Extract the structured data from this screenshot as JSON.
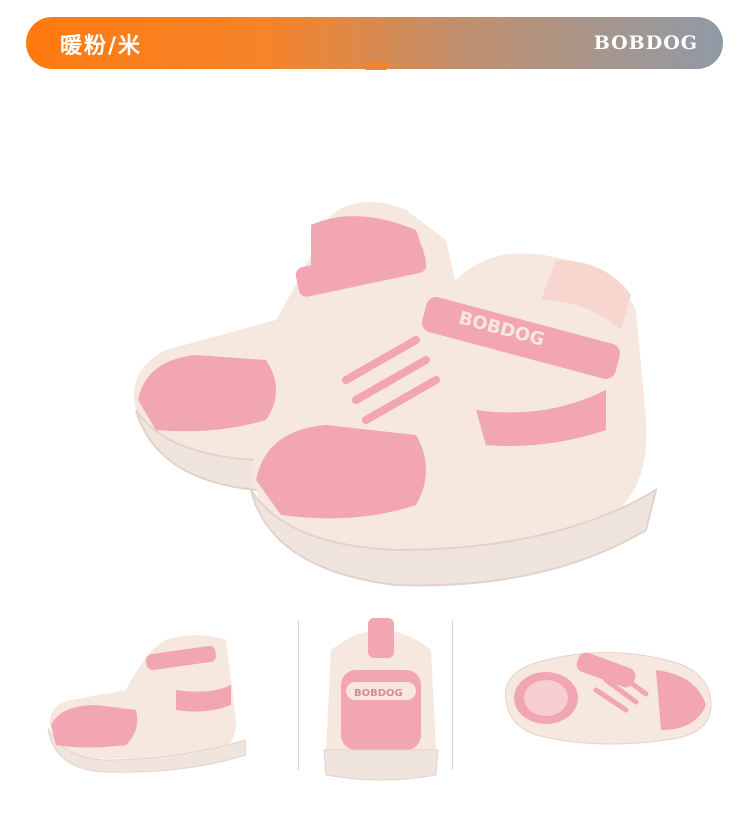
{
  "header": {
    "color_name": "暖粉/米",
    "brand": "BOBDOG"
  },
  "hero_image": {
    "logo_text": "BOBDOG"
  },
  "thumbnails": [
    {
      "view": "side"
    },
    {
      "view": "back",
      "logo_text": "BOBDOG"
    },
    {
      "view": "top"
    }
  ],
  "colors": {
    "pink": "#f1a6b1",
    "cream": "#f6e7df",
    "sole": "#efe4de",
    "header_orange": "#ff7a10",
    "header_grey": "#8f9aa6"
  }
}
